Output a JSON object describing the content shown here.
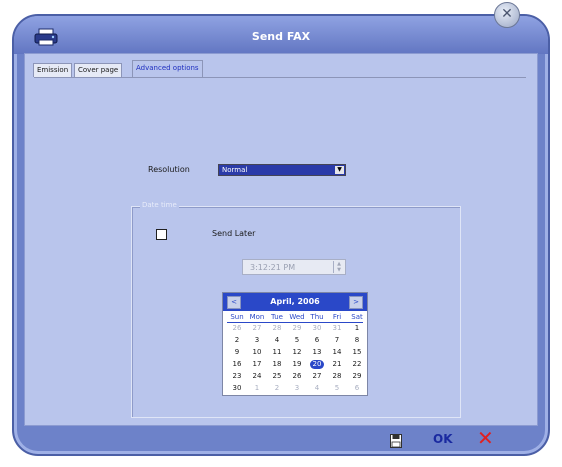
{
  "window": {
    "title": "Send FAX",
    "close_glyph": "✕"
  },
  "tabs": [
    {
      "label": "Emission",
      "active": false
    },
    {
      "label": "Cover page",
      "active": false
    },
    {
      "label": "Advanced options",
      "active": true
    }
  ],
  "resolution": {
    "label": "Resolution",
    "value": "Normal"
  },
  "date_time": {
    "legend": "Date time",
    "send_later_label": "Send Later",
    "send_later_checked": false,
    "time_value": "3:12:21 PM"
  },
  "calendar": {
    "month_year": "April, 2006",
    "prev": "<",
    "next": ">",
    "weekdays": [
      "Sun",
      "Mon",
      "Tue",
      "Wed",
      "Thu",
      "Fri",
      "Sat"
    ],
    "weeks": [
      [
        "26",
        "27",
        "28",
        "29",
        "30",
        "31",
        "1"
      ],
      [
        "2",
        "3",
        "4",
        "5",
        "6",
        "7",
        "8"
      ],
      [
        "9",
        "10",
        "11",
        "12",
        "13",
        "14",
        "15"
      ],
      [
        "16",
        "17",
        "18",
        "19",
        "20",
        "21",
        "22"
      ],
      [
        "23",
        "24",
        "25",
        "26",
        "27",
        "28",
        "29"
      ],
      [
        "30",
        "1",
        "2",
        "3",
        "4",
        "5",
        "6"
      ]
    ],
    "selected_day": "20"
  },
  "buttons": {
    "save_icon": "floppy-disk-icon",
    "ok_label": "OK",
    "cancel_glyph": "✕"
  },
  "colors": {
    "window_frame": "#6d82c9",
    "client_bg": "#b9c5ec",
    "calendar_accent": "#2a48c8",
    "cancel": "#e02020",
    "ok": "#1a2aa0"
  }
}
